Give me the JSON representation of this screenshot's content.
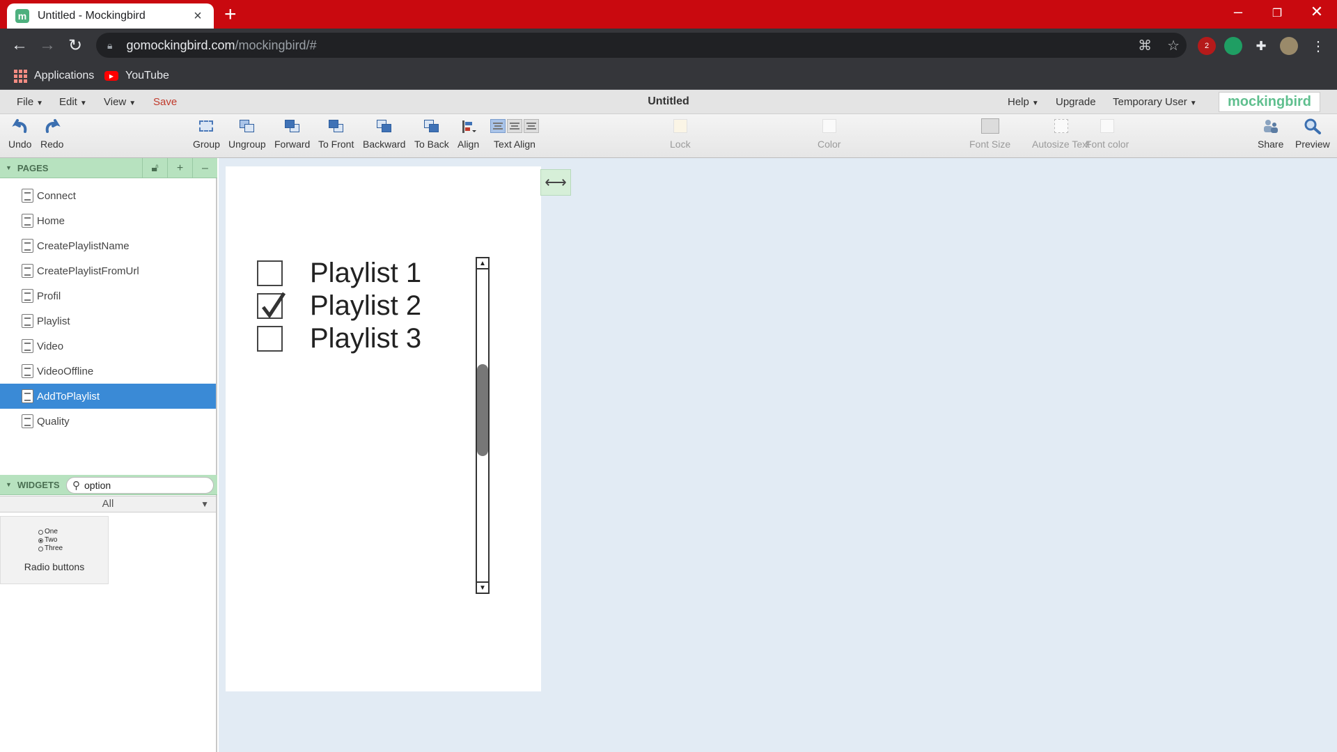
{
  "browser": {
    "tab_title": "Untitled - Mockingbird",
    "tab_favicon": "m",
    "url_host": "gomockingbird.com",
    "url_path": "/mockingbird/#",
    "extension_badge": "2",
    "bookmarks": [
      {
        "label": "Applications",
        "icon": "apps-grid-icon"
      },
      {
        "label": "YouTube",
        "icon": "youtube-icon"
      }
    ],
    "colors": {
      "frame": "#c9090f",
      "toolbar": "#35363a"
    }
  },
  "menubar": {
    "file": "File",
    "edit": "Edit",
    "view": "View",
    "save": "Save",
    "doc_title": "Untitled",
    "help": "Help",
    "upgrade": "Upgrade",
    "user": "Temporary User",
    "brand": "mockingbird"
  },
  "toolbar": {
    "undo": "Undo",
    "redo": "Redo",
    "group": "Group",
    "ungroup": "Ungroup",
    "forward": "Forward",
    "to_front": "To Front",
    "backward": "Backward",
    "to_back": "To Back",
    "align": "Align",
    "text_align": "Text Align",
    "lock": "Lock",
    "color": "Color",
    "font_size": "Font Size",
    "autosize_text": "Autosize Text",
    "font_color": "Font color",
    "share": "Share",
    "preview": "Preview"
  },
  "sidebar": {
    "pages_title": "PAGES",
    "pages": [
      {
        "label": "Connect",
        "selected": false
      },
      {
        "label": "Home",
        "selected": false
      },
      {
        "label": "CreatePlaylistName",
        "selected": false
      },
      {
        "label": "CreatePlaylistFromUrl",
        "selected": false
      },
      {
        "label": "Profil",
        "selected": false
      },
      {
        "label": "Playlist",
        "selected": false
      },
      {
        "label": "Video",
        "selected": false
      },
      {
        "label": "VideoOffline",
        "selected": false
      },
      {
        "label": "AddToPlaylist",
        "selected": true
      },
      {
        "label": "Quality",
        "selected": false
      }
    ],
    "widgets_title": "WIDGETS",
    "widget_search_value": "option",
    "widget_filter": "All",
    "widget_tiles": [
      {
        "label": "Radio buttons",
        "options": [
          "One",
          "Two",
          "Three"
        ],
        "selected_option": "Two"
      }
    ]
  },
  "canvas": {
    "items": [
      {
        "label": "Playlist 1",
        "checked": false
      },
      {
        "label": "Playlist 2",
        "checked": true
      },
      {
        "label": "Playlist 3",
        "checked": false
      }
    ],
    "accent": "#e2ebf4"
  }
}
